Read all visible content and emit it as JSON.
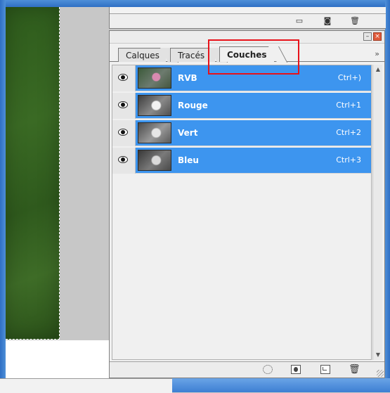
{
  "upper_panel": {
    "toolbar_icons": [
      "new-layer-icon",
      "camera-icon",
      "trash-icon"
    ]
  },
  "channels_panel": {
    "tabs": [
      {
        "label": "Calques",
        "active": false
      },
      {
        "label": "Tracés",
        "active": false
      },
      {
        "label": "Couches",
        "active": true
      }
    ],
    "more_label": "»",
    "channels": [
      {
        "name": "RVB",
        "shortcut": "Ctrl+)",
        "visible": true,
        "thumb": "color"
      },
      {
        "name": "Rouge",
        "shortcut": "Ctrl+1",
        "visible": true,
        "thumb": "grey"
      },
      {
        "name": "Vert",
        "shortcut": "Ctrl+2",
        "visible": true,
        "thumb": "grey"
      },
      {
        "name": "Bleu",
        "shortcut": "Ctrl+3",
        "visible": true,
        "thumb": "grey"
      }
    ],
    "footer_icons": [
      "load-selection-icon",
      "save-selection-icon",
      "new-channel-icon",
      "delete-channel-icon"
    ],
    "selection_color": "#3d95ef",
    "highlight_color": "#e8121a"
  }
}
